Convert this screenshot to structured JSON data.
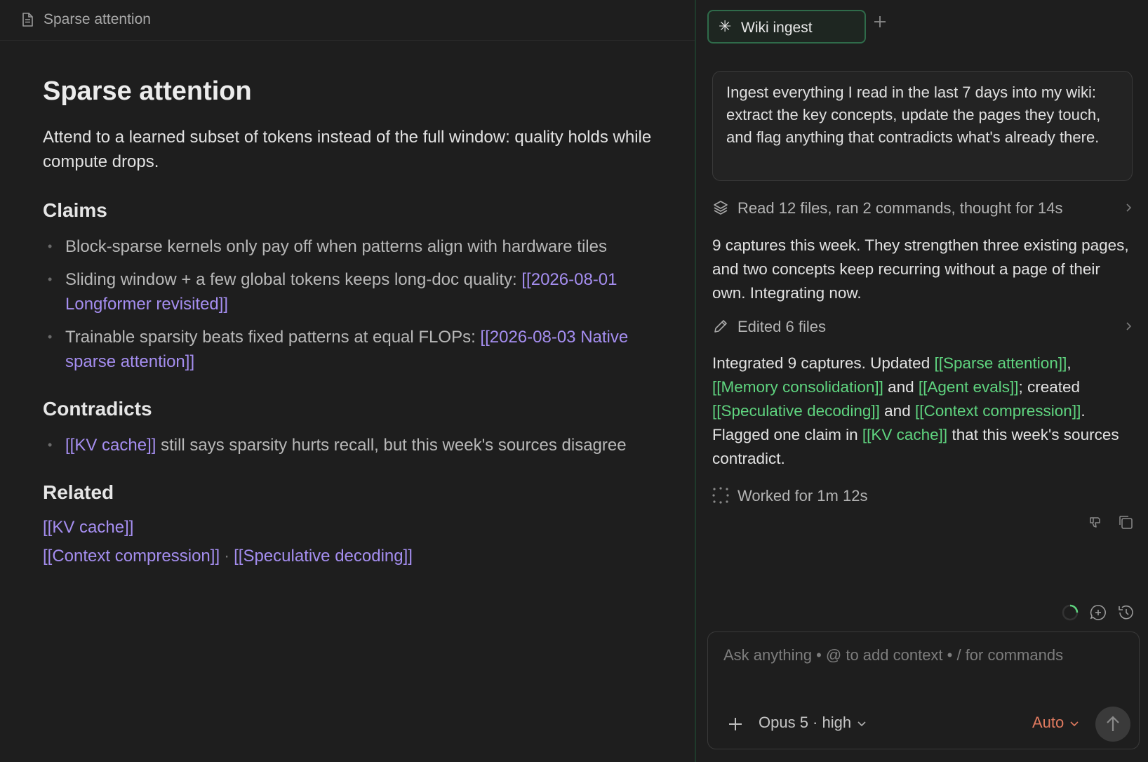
{
  "doc": {
    "tab_title": "Sparse attention",
    "title": "Sparse attention",
    "lede": "Attend to a learned subset of tokens instead of the full window: quality holds while compute drops.",
    "claims_heading": "Claims",
    "claims": [
      {
        "text": "Block-sparse kernels only pay off when patterns align with hardware tiles",
        "link": ""
      },
      {
        "text": "Sliding window + a few global tokens keeps long-doc quality: ",
        "link": "[[2026-08-01 Longformer revisited]]"
      },
      {
        "text": "Trainable sparsity beats fixed patterns at equal FLOPs: ",
        "link": "[[2026-08-03 Native sparse attention]]"
      }
    ],
    "contradicts_heading": "Contradicts",
    "contradicts": {
      "link": "[[KV cache]]",
      "text": " still says sparsity hurts recall, but this week's sources disagree"
    },
    "related_heading": "Related",
    "related": {
      "line1": "[[KV cache]]",
      "line2a": "[[Context compression]]",
      "sep": "·",
      "line2b": "[[Speculative decoding]]"
    }
  },
  "chat": {
    "tab_label": "Wiki ingest",
    "tab_icon": "sparkle-icon",
    "prompt": "Ingest everything I read in the last 7 days into my wiki: extract the key concepts, update the pages they touch, and flag anything that contradicts what's already there.",
    "activity1": "Read 12 files, ran 2 commands, thought for 14s",
    "response1": "9 captures this week. They strengthen three existing pages, and two concepts keep recurring without a page of their own. Integrating now.",
    "activity2": "Edited 6 files",
    "r2": {
      "p1": "Integrated 9 captures. Updated ",
      "l1": "[[Sparse attention]]",
      "p2": ", ",
      "l2": "[[Memory consolidation]]",
      "p3": " and ",
      "l3": "[[Agent evals]]",
      "p4": "; created ",
      "l4": "[[Speculative decoding]]",
      "p5": " and ",
      "l5": "[[Context compression]]",
      "p6": ". Flagged one claim in ",
      "l6": "[[KV cache]]",
      "p7": " that this week's sources contradict."
    },
    "worked": "Worked for 1m 12s",
    "composer": {
      "placeholder": "Ask anything • @ to add context • / for commands",
      "model": "Opus 5 · high",
      "mode": "Auto"
    }
  },
  "colors": {
    "wikilink_doc": "#a58ef0",
    "wikilink_chat": "#5fd47f",
    "tab_border": "#2f6b4a",
    "mode_accent": "#e07a5f"
  }
}
